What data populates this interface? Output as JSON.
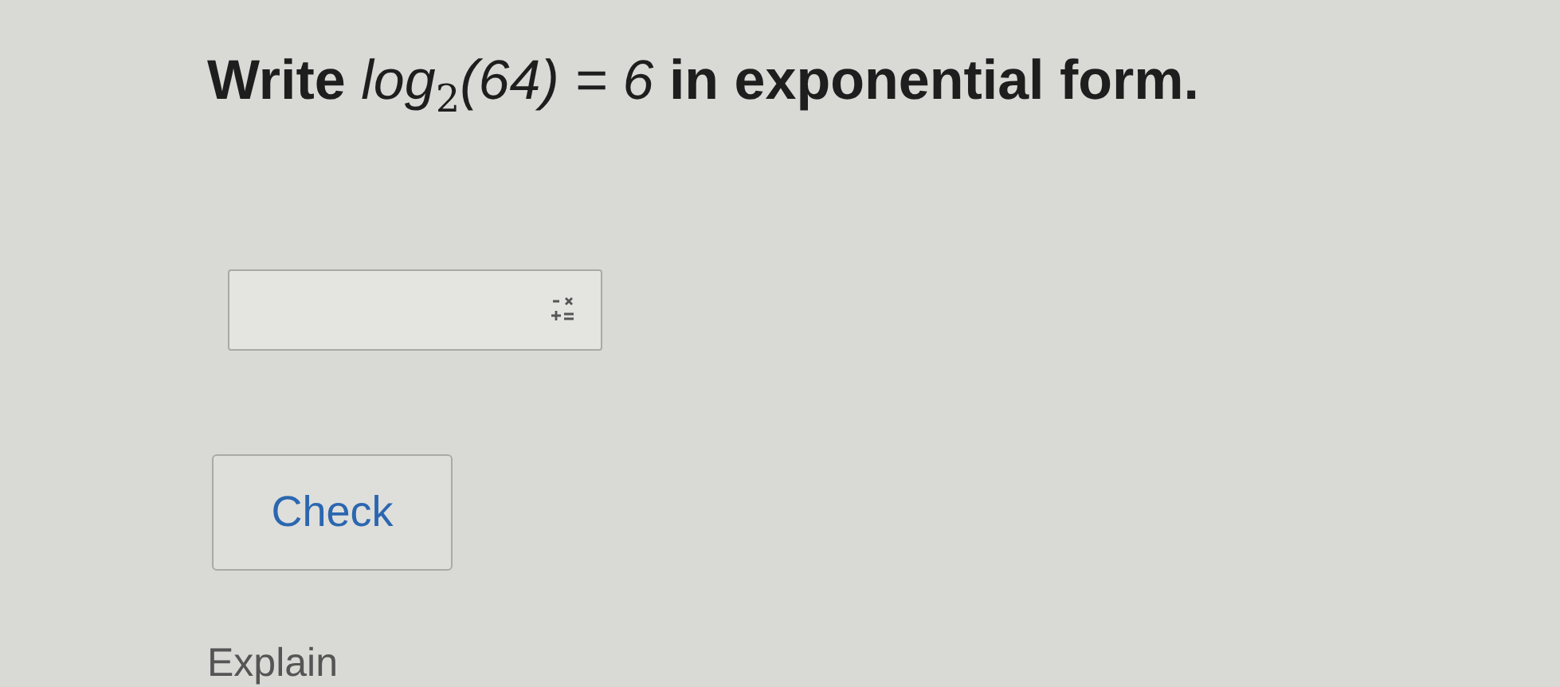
{
  "question": "**Write** *log*$_{2}$*(64) = 6* **in exponential form.**",
  "check_button": {
    "label": "Check"
  },
  "explain_link": {
    "label": "Explain"
  }
}
